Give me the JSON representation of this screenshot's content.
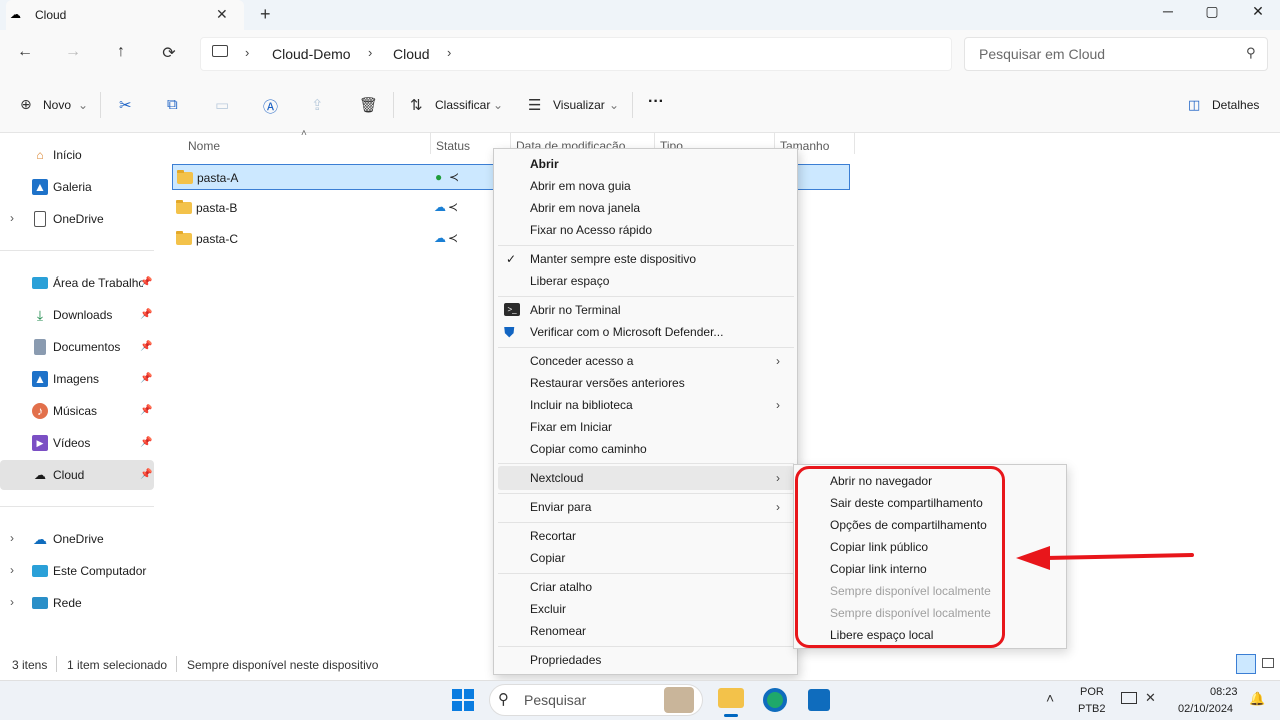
{
  "window": {
    "title": "Cloud",
    "new_tab": "+",
    "minimize": "─",
    "maximize": "▢",
    "close": "✕",
    "tab_close": "✕"
  },
  "nav": {
    "back": "←",
    "forward": "→",
    "up": "↑",
    "refresh": "⟳",
    "crumbs": [
      "Cloud-Demo",
      "Cloud"
    ],
    "search_placeholder": "Pesquisar em Cloud"
  },
  "toolbar": {
    "new_label": "Novo",
    "sort_label": "Classificar",
    "view_label": "Visualizar",
    "more": "···",
    "details_label": "Detalhes"
  },
  "sidebar": {
    "items": [
      {
        "label": "Início"
      },
      {
        "label": "Galeria"
      },
      {
        "label": "OneDrive"
      },
      {
        "label": "Área de Trabalho"
      },
      {
        "label": "Downloads"
      },
      {
        "label": "Documentos"
      },
      {
        "label": "Imagens"
      },
      {
        "label": "Músicas"
      },
      {
        "label": "Vídeos"
      },
      {
        "label": "Cloud"
      },
      {
        "label": "OneDrive"
      },
      {
        "label": "Este Computador"
      },
      {
        "label": "Rede"
      }
    ]
  },
  "columns": {
    "name": "Nome",
    "status": "Status",
    "modified": "Data de modificação",
    "type": "Tipo",
    "size": "Tamanho"
  },
  "files": [
    {
      "name": "pasta-A"
    },
    {
      "name": "pasta-B"
    },
    {
      "name": "pasta-C"
    }
  ],
  "context_menu": {
    "items": [
      "Abrir",
      "Abrir em nova guia",
      "Abrir em nova janela",
      "Fixar no Acesso rápido",
      "Manter sempre este dispositivo",
      "Liberar espaço",
      "Abrir no Terminal",
      "Verificar com o Microsoft Defender...",
      "Conceder acesso a",
      "Restaurar versões anteriores",
      "Incluir na biblioteca",
      "Fixar em Iniciar",
      "Copiar como caminho",
      "Nextcloud",
      "Enviar para",
      "Recortar",
      "Copiar",
      "Criar atalho",
      "Excluir",
      "Renomear",
      "Propriedades"
    ]
  },
  "submenu": {
    "items": [
      "Abrir no navegador",
      "Sair deste compartilhamento",
      "Opções de compartilhamento",
      "Copiar link público",
      "Copiar link interno",
      "Sempre disponível localmente",
      "Sempre disponível localmente",
      "Libere espaço local"
    ]
  },
  "statusbar": {
    "count": "3 itens",
    "selected": "1 item selecionado",
    "availability": "Sempre disponível neste dispositivo"
  },
  "taskbar": {
    "search_placeholder": "Pesquisar",
    "lang1": "POR",
    "lang2": "PTB2",
    "time": "08:23",
    "date": "02/10/2024"
  },
  "colors": {
    "accent": "#0067c0",
    "annotation": "#e8161b",
    "selection": "#cce8ff"
  }
}
